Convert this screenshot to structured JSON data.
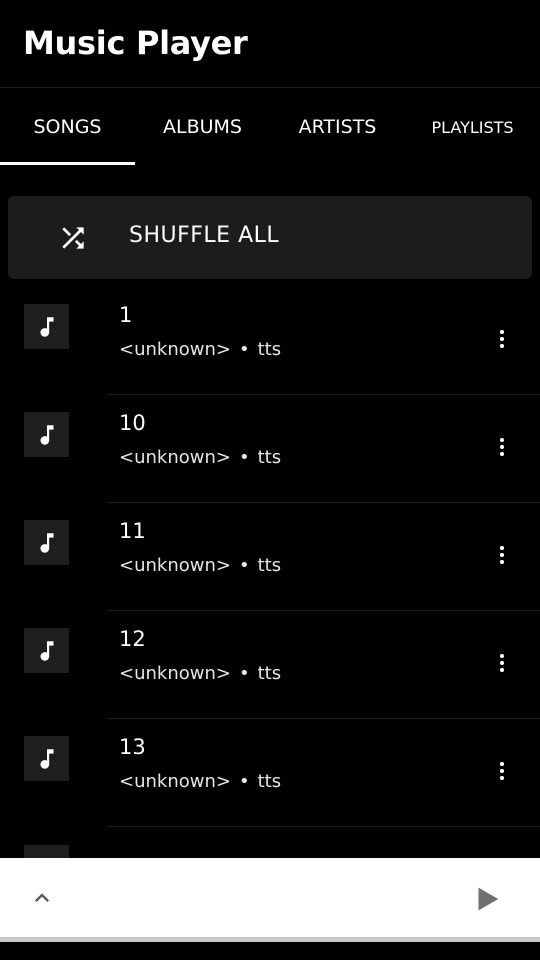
{
  "app": {
    "title": "Music Player"
  },
  "tabs": [
    {
      "label": "SONGS",
      "selected": true
    },
    {
      "label": "ALBUMS",
      "selected": false
    },
    {
      "label": "ARTISTS",
      "selected": false
    },
    {
      "label": "PLAYLISTS",
      "selected": false
    }
  ],
  "shuffle": {
    "label": "SHUFFLE ALL",
    "icon": "shuffle-icon"
  },
  "songs": [
    {
      "title": "1",
      "artist": "<unknown>",
      "separator": "•",
      "album": "tts"
    },
    {
      "title": "10",
      "artist": "<unknown>",
      "separator": "•",
      "album": "tts"
    },
    {
      "title": "11",
      "artist": "<unknown>",
      "separator": "•",
      "album": "tts"
    },
    {
      "title": "12",
      "artist": "<unknown>",
      "separator": "•",
      "album": "tts"
    },
    {
      "title": "13",
      "artist": "<unknown>",
      "separator": "•",
      "album": "tts"
    }
  ],
  "icons": {
    "song": "music-note-icon",
    "more": "more-vert-icon",
    "expand": "chevron-up-icon",
    "play": "play-icon"
  },
  "colors": {
    "background": "#000000",
    "surface": "#1c1c1c",
    "text": "#ffffff",
    "miniplayer": "#ffffff",
    "play_icon": "#6f6f6f"
  }
}
